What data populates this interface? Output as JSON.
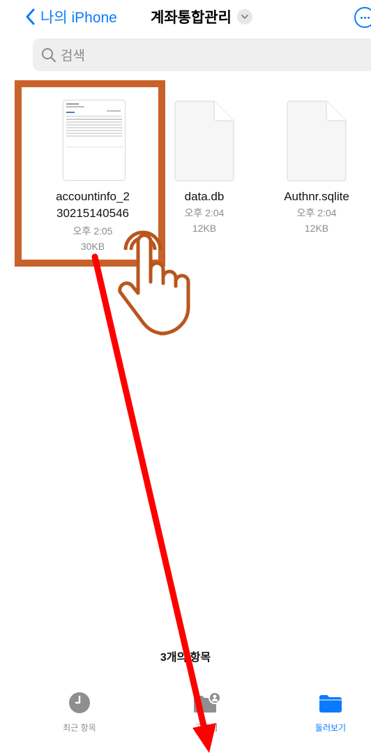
{
  "nav": {
    "back_label": "나의 iPhone",
    "title": "계좌통합관리"
  },
  "search": {
    "placeholder": "검색"
  },
  "files": [
    {
      "name_line1": "accountinfo_2",
      "name_line2": "30215140546",
      "time": "오후 2:05",
      "size": "30KB"
    },
    {
      "name_line1": "data.db",
      "time": "오후 2:04",
      "size": "12KB"
    },
    {
      "name_line1": "Authnr.sqlite",
      "time": "오후 2:04",
      "size": "12KB"
    }
  ],
  "item_count": "3개의 항목",
  "tabs": [
    {
      "label": "최근 항목",
      "icon": "clock-icon"
    },
    {
      "label": "공유됨",
      "icon": "shared-folder-icon"
    },
    {
      "label": "둘러보기",
      "icon": "folder-icon"
    }
  ],
  "colors": {
    "accent": "#0a7aff",
    "highlight": "#c9612a",
    "arrow": "#ff0000"
  }
}
